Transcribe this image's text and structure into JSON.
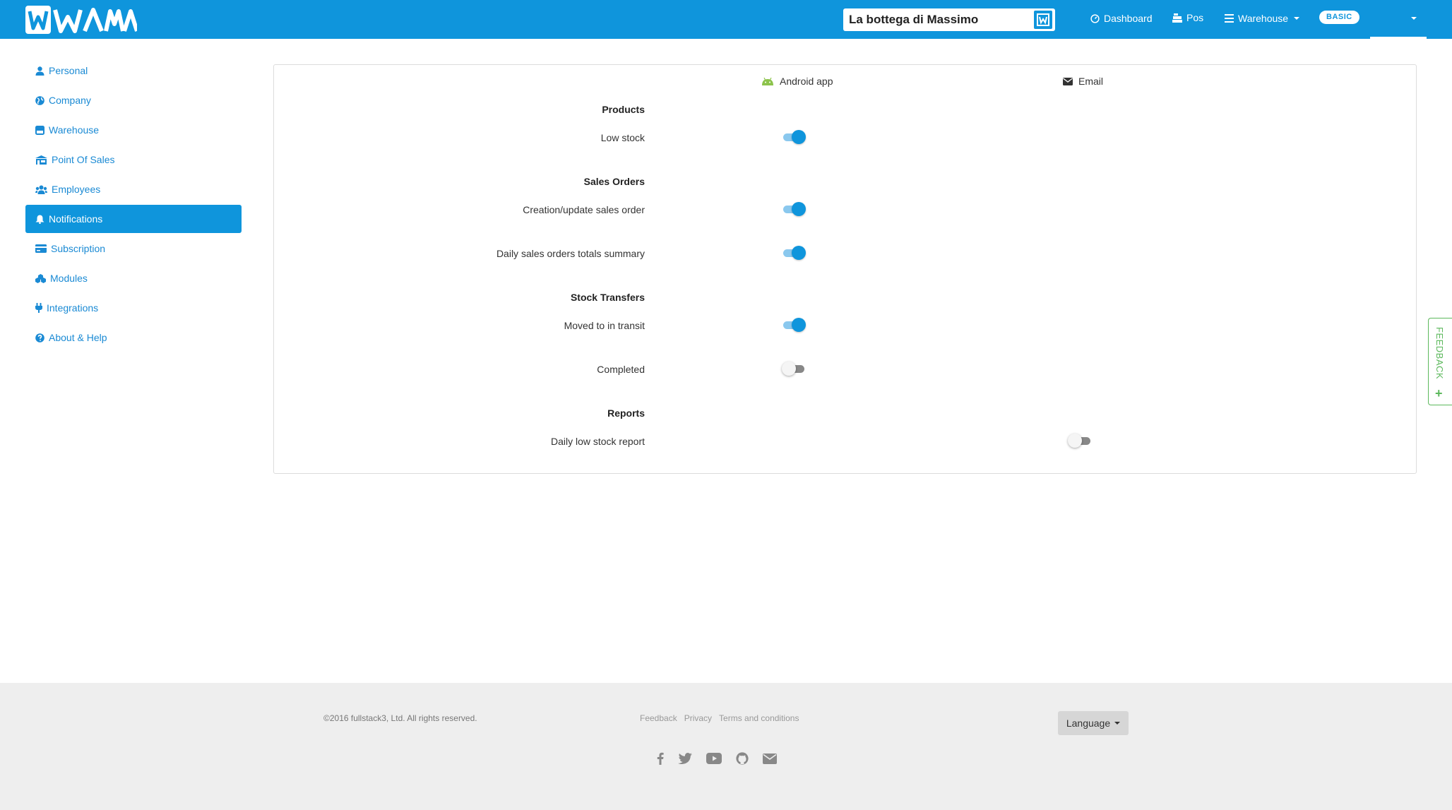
{
  "app": {
    "logo_text": "WAMA"
  },
  "header": {
    "company_name": "La bottega di Massimo",
    "nav": {
      "dashboard": "Dashboard",
      "pos": "Pos",
      "warehouse": "Warehouse"
    },
    "plan_badge": "BASIC"
  },
  "sidebar": {
    "items": [
      {
        "label": "Personal",
        "icon": "user-icon"
      },
      {
        "label": "Company",
        "icon": "globe-icon"
      },
      {
        "label": "Warehouse",
        "icon": "warehouse-icon"
      },
      {
        "label": "Point Of Sales",
        "icon": "store-icon"
      },
      {
        "label": "Employees",
        "icon": "users-icon"
      },
      {
        "label": "Notifications",
        "icon": "bell-icon",
        "active": true
      },
      {
        "label": "Subscription",
        "icon": "credit-card-icon"
      },
      {
        "label": "Modules",
        "icon": "cubes-icon"
      },
      {
        "label": "Integrations",
        "icon": "plug-icon"
      },
      {
        "label": "About & Help",
        "icon": "question-circle-icon"
      }
    ]
  },
  "notifications": {
    "columns": {
      "android": "Android app",
      "email": "Email"
    },
    "sections": [
      {
        "title": "Products",
        "rows": [
          {
            "label": "Low stock",
            "android": true
          }
        ]
      },
      {
        "title": "Sales Orders",
        "rows": [
          {
            "label": "Creation/update sales order",
            "android": true
          },
          {
            "label": "Daily sales orders totals summary",
            "android": true
          }
        ]
      },
      {
        "title": "Stock Transfers",
        "rows": [
          {
            "label": "Moved to in transit",
            "android": true
          },
          {
            "label": "Completed",
            "android": false
          }
        ]
      },
      {
        "title": "Reports",
        "rows": [
          {
            "label": "Daily low stock report",
            "email": false
          }
        ]
      }
    ]
  },
  "feedback_tab": {
    "label": "FEEDBACK",
    "plus": "+"
  },
  "footer": {
    "copyright": "©2016 fullstack3, Ltd. All rights reserved.",
    "links": [
      "Feedback",
      "Privacy",
      "Terms and conditions"
    ],
    "language_label": "Language",
    "social_icons": [
      "facebook-icon",
      "twitter-icon",
      "youtube-icon",
      "github-icon",
      "envelope-icon"
    ]
  },
  "colors": {
    "brand": "#0f95dc",
    "feedback": "#5cb85c",
    "footer_bg": "#eeeeee"
  }
}
